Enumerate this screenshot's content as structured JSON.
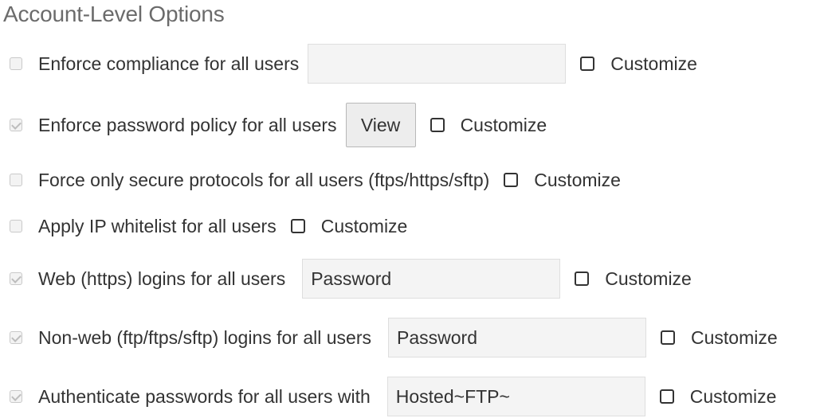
{
  "panel": {
    "title": "Account-Level Options"
  },
  "options": [
    {
      "label": "Enforce compliance for all users",
      "checked": false,
      "field_value": "",
      "customize_label": "Customize"
    },
    {
      "label": "Enforce password policy for all users",
      "checked": true,
      "button_label": "View",
      "customize_label": "Customize"
    },
    {
      "label": "Force only secure protocols for all users (ftps/https/sftp)",
      "checked": false,
      "customize_label": "Customize"
    },
    {
      "label": "Apply IP whitelist for all users",
      "checked": false,
      "customize_label": "Customize"
    },
    {
      "label": "Web (https) logins for all users",
      "checked": true,
      "field_value": "Password",
      "customize_label": "Customize"
    },
    {
      "label": "Non-web (ftp/ftps/sftp) logins for all users",
      "checked": true,
      "field_value": "Password",
      "customize_label": "Customize"
    },
    {
      "label": "Authenticate passwords for all users with",
      "checked": true,
      "field_value": "Hosted~FTP~",
      "customize_label": "Customize"
    }
  ]
}
